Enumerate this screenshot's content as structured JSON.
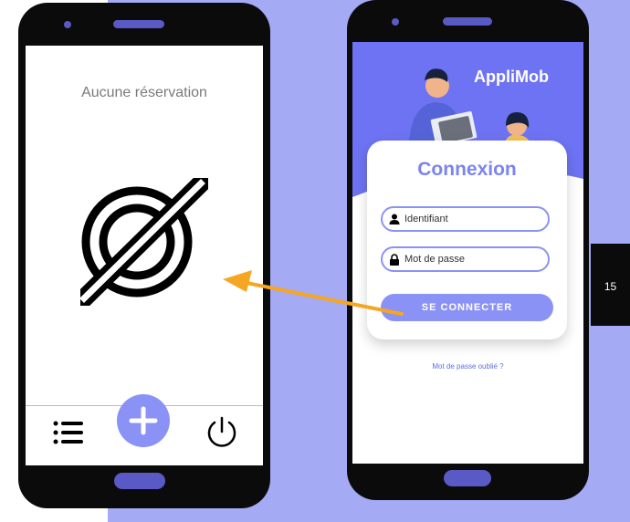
{
  "left_screen": {
    "empty_title": "Aucune réservation",
    "empty_icon": "no-reservation-icon",
    "bottom_nav": {
      "list_icon": "list-icon",
      "add_icon": "plus-icon",
      "power_icon": "power-icon"
    }
  },
  "right_screen": {
    "app_name": "AppliMob",
    "login_card": {
      "title": "Connexion",
      "username_placeholder": "Identifiant",
      "password_placeholder": "Mot de passe",
      "connect_label": "SE CONNECTER"
    },
    "forgot_password": "Mot de passe oublié ?"
  },
  "page_number": "15",
  "colors": {
    "accent": "#8b92f6",
    "hero": "#6d73f2",
    "background_panel": "#a4aaf4",
    "arrow": "#f5a623"
  }
}
